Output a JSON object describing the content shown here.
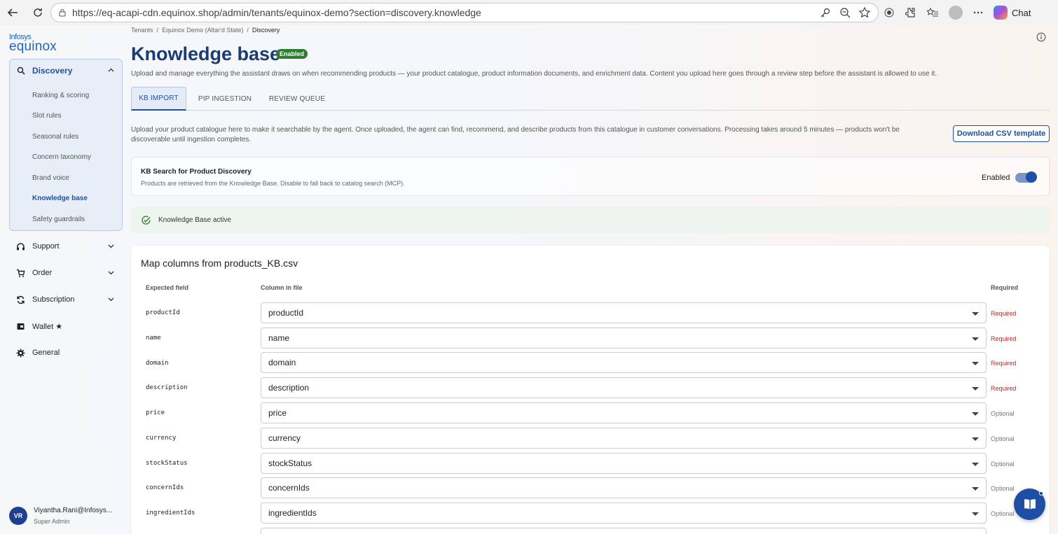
{
  "browser": {
    "url": "https://eq-acapi-cdn.equinox.shop/admin/tenants/equinox-demo?section=discovery.knowledge",
    "chat_label": "Chat"
  },
  "logo": {
    "small": "Infosys",
    "big": "equinox"
  },
  "sidebar": {
    "discovery": {
      "label": "Discovery",
      "items": [
        "Ranking & scoring",
        "Slot rules",
        "Seasonal rules",
        "Concern taxonomy",
        "Brand voice",
        "Knowledge base",
        "Safety guardrails"
      ]
    },
    "nav": [
      {
        "label": "Support",
        "icon": "headset-icon"
      },
      {
        "label": "Order",
        "icon": "cart-icon"
      },
      {
        "label": "Subscription",
        "icon": "refresh-icon"
      },
      {
        "label": "Wallet ★",
        "icon": "wallet-icon"
      },
      {
        "label": "General",
        "icon": "gear-icon"
      }
    ],
    "user": {
      "initials": "VR",
      "name": "Viyantha.Rani@Infosys...",
      "role": "Super Admin"
    }
  },
  "breadcrumb": {
    "items": [
      "Tenants",
      "Equinox Demo (Altar'd State)",
      "Discovery"
    ],
    "sep": "/"
  },
  "page": {
    "title": "Knowledge base",
    "badge": "Enabled",
    "description": "Upload and manage everything the assistant draws on when recommending products — your product catalogue, product information documents, and enrichment data. Content you upload here goes through a review step before the assistant is allowed to use it."
  },
  "tabs": [
    "KB IMPORT",
    "PIP INGESTION",
    "REVIEW QUEUE"
  ],
  "import": {
    "text": "Upload your product catalogue here to make it searchable by the agent. Once uploaded, the agent can find, recommend, and describe products from this catalogue in customer conversations. Processing takes around 5 minutes — products won't be discoverable until ingestion completes.",
    "download_label": "Download CSV template"
  },
  "kb_search": {
    "title": "KB Search for Product Discovery",
    "subtitle": "Products are retrieved from the Knowledge Base. Disable to fall back to catalog search (MCP).",
    "state_label": "Enabled"
  },
  "status": {
    "label": "Knowledge Base active"
  },
  "mapping": {
    "title": "Map columns from products_KB.csv",
    "headers": {
      "expected": "Expected field",
      "column": "Column in file",
      "required": "Required"
    },
    "rows": [
      {
        "field": "productId",
        "value": "productId",
        "req": "Required"
      },
      {
        "field": "name",
        "value": "name",
        "req": "Required"
      },
      {
        "field": "domain",
        "value": "domain",
        "req": "Required"
      },
      {
        "field": "description",
        "value": "description",
        "req": "Required"
      },
      {
        "field": "price",
        "value": "price",
        "req": "Optional"
      },
      {
        "field": "currency",
        "value": "currency",
        "req": "Optional"
      },
      {
        "field": "stockStatus",
        "value": "stockStatus",
        "req": "Optional"
      },
      {
        "field": "concernIds",
        "value": "concernIds",
        "req": "Optional"
      },
      {
        "field": "ingredientIds",
        "value": "ingredientIds",
        "req": "Optional"
      }
    ]
  },
  "colors": {
    "primary": "#1f4fa5",
    "title": "#1a3b73",
    "success": "#2e7d32",
    "required": "#c62828"
  }
}
